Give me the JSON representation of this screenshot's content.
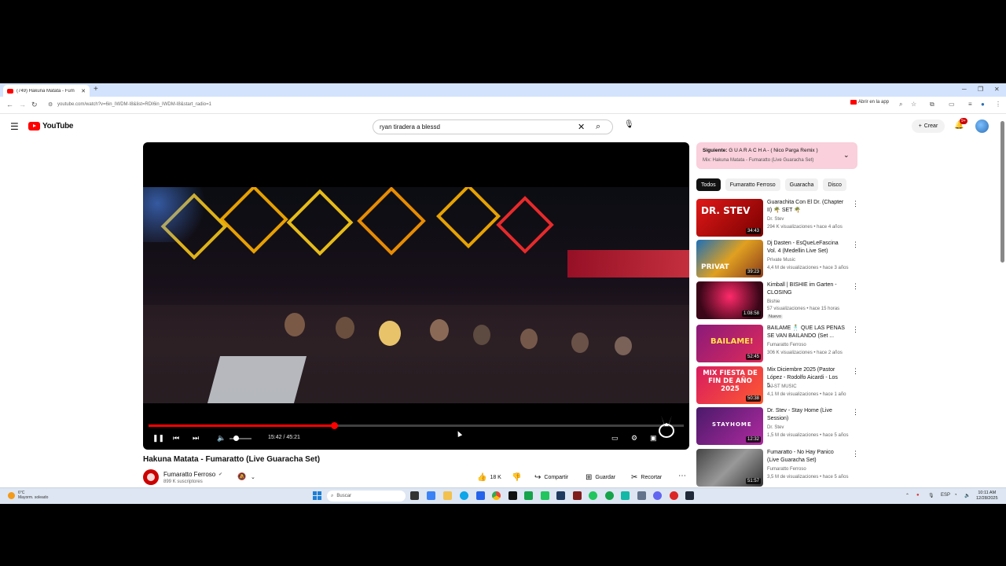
{
  "browser": {
    "tab_title": "(749) Hakuna Matata - Fum",
    "new_tab_icon": "plus-icon",
    "url": "youtube.com/watch?v=6in_IWDM-I8&list=RDI6in_IWDM-I8&start_radio=1",
    "open_in_app": "Abrir en la app"
  },
  "yt": {
    "logo_text": "YouTube",
    "search_value": "ryan tiradera a blessd",
    "create_label": "Crear",
    "notif_count": "9+"
  },
  "player": {
    "time": "15:42 / 45:21",
    "progress": 0.346,
    "volume": 0.3
  },
  "video": {
    "title": "Hakuna Matata - Fumaratto (Live Guaracha Set)",
    "channel": "Fumaratto Ferroso",
    "subs": "899 K suscriptores",
    "likes": "18 K",
    "share": "Compartir",
    "save": "Guardar",
    "clip": "Recortar"
  },
  "upnext": {
    "label": "Siguiente:",
    "next_title": "G U A R A C H A - ( Nico Parga Remix )",
    "mix": "Mix: Hakuna Matata - Fumaratto (Live Guaracha Set)"
  },
  "chips": [
    "Todos",
    "Fumaratto Ferroso",
    "Guaracha",
    "Disco"
  ],
  "recs": [
    {
      "title": "Guarachita Con El Dr. (Chapter II) 🌴 SET 🌴",
      "channel": "Dr. Stev",
      "meta": "294 K visualizaciones • hace 4 años",
      "duration": "34:43",
      "thumb_text": "DR. STEV",
      "new": ""
    },
    {
      "title": "Dj Dasten - EsQueLeFascina Vol. 4 (Medellin Live Set)",
      "channel": "Private Music",
      "meta": "4,4 M de visualizaciones • hace 3 años",
      "duration": "39:23",
      "thumb_text": "PRIVAT",
      "new": ""
    },
    {
      "title": "Kimball | BISHIE im Garten - CLOSING",
      "channel": "Bishie",
      "meta": "57 visualizaciones • hace 15 horas",
      "duration": "1:08:58",
      "thumb_text": "",
      "new": "Nuevo"
    },
    {
      "title": "BAILAME 🕺 QUE LAS PENAS SE VAN BAILANDO (Set ...",
      "channel": "Fumaratto Ferroso",
      "meta": "306 K visualizaciones • hace 2 años",
      "duration": "52:45",
      "thumb_text": "BAILAME!",
      "new": ""
    },
    {
      "title": "Mix Diciembre 2025 (Pastor López - Rodolfo Aicardi - Los 5...",
      "channel": "DJ ST MUSIC",
      "meta": "4,1 M de visualizaciones • hace 1 año",
      "duration": "50:38",
      "thumb_text": "MIX FIESTA DE FIN DE AÑO 2025",
      "new": ""
    },
    {
      "title": "Dr. Stev - Stay Home (Live Session)",
      "channel": "Dr. Stev",
      "meta": "1,5 M de visualizaciones • hace 5 años",
      "duration": "12:32",
      "thumb_text": "STAYHOME",
      "new": ""
    },
    {
      "title": "Fumaratto - No Hay Panico (Live Guaracha Set)",
      "channel": "Fumaratto Ferroso",
      "meta": "3,5 M de visualizaciones • hace 5 años",
      "duration": "51:57",
      "thumb_text": "",
      "new": ""
    }
  ],
  "taskbar": {
    "weather_temp": "6°C",
    "weather_desc": "Mayorm. soleado",
    "search_placeholder": "Buscar",
    "lang": "ESP",
    "time": "10:11 AM",
    "date": "12/28/2025"
  },
  "colors": {
    "accent": "#ff0000",
    "upnext_bg": "#f9d0dc"
  }
}
